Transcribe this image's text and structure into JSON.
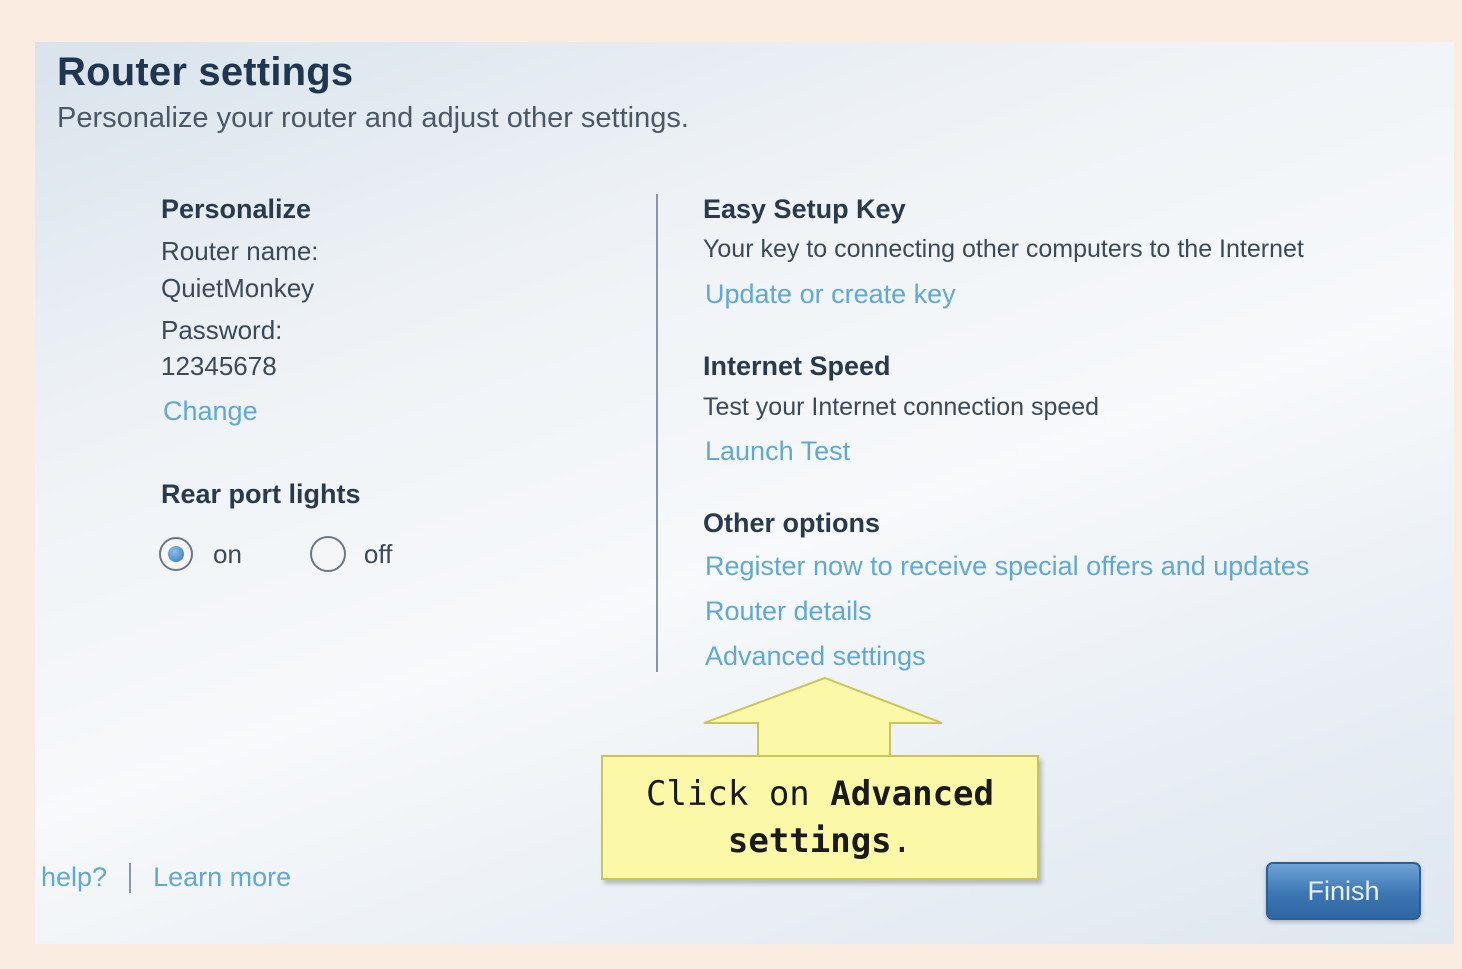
{
  "header": {
    "title": "Router settings",
    "subtitle": "Personalize your router and adjust other settings."
  },
  "personalize": {
    "heading": "Personalize",
    "router_name_label": "Router name:",
    "router_name_value": "QuietMonkey",
    "password_label": "Password:",
    "password_value": "12345678",
    "change_link": "Change"
  },
  "rear_port_lights": {
    "heading": "Rear port lights",
    "selected": "on",
    "options": [
      {
        "label": "on",
        "checked": true
      },
      {
        "label": "off",
        "checked": false
      }
    ]
  },
  "easy_setup_key": {
    "heading": "Easy Setup Key",
    "description": "Your key to connecting other computers to the Internet",
    "link": "Update or create key"
  },
  "internet_speed": {
    "heading": "Internet Speed",
    "description": "Test your Internet connection speed",
    "link": "Launch Test"
  },
  "other_options": {
    "heading": "Other options",
    "links": [
      "Register now to receive special offers and updates",
      "Router details",
      "Advanced settings"
    ]
  },
  "footer": {
    "help_link": "help?",
    "learn_more_link": "Learn more",
    "finish_button": "Finish"
  },
  "callout": {
    "prefix": "Click on ",
    "bold": "Advanced settings",
    "suffix": "."
  },
  "colors": {
    "link": "#5fa8d9",
    "title": "#1f3650",
    "callout_fill": "#fbf8a8",
    "finish_button": "#3c76b3"
  }
}
